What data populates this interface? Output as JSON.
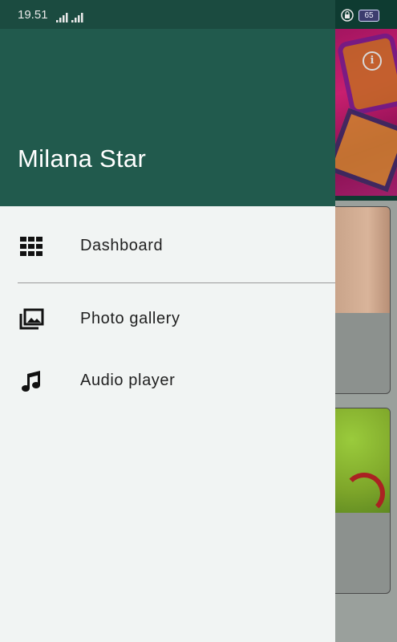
{
  "status_bar": {
    "time": "19.51",
    "battery": "65",
    "icons": [
      "signal-icon",
      "signal-icon",
      "lock-icon",
      "battery-icon"
    ]
  },
  "drawer": {
    "title": "Milana Star",
    "items": [
      {
        "label": "Dashboard",
        "icon": "grid-icon"
      },
      {
        "label": "Photo gallery",
        "icon": "photo-library-icon"
      },
      {
        "label": "Audio player",
        "icon": "music-note-icon"
      }
    ]
  },
  "background": {
    "info_icon": "i"
  },
  "colors": {
    "drawer_header": "#215a4d",
    "drawer_body": "#f1f4f3",
    "scrim": "#9aa09c",
    "banner": "#c81f6f"
  }
}
